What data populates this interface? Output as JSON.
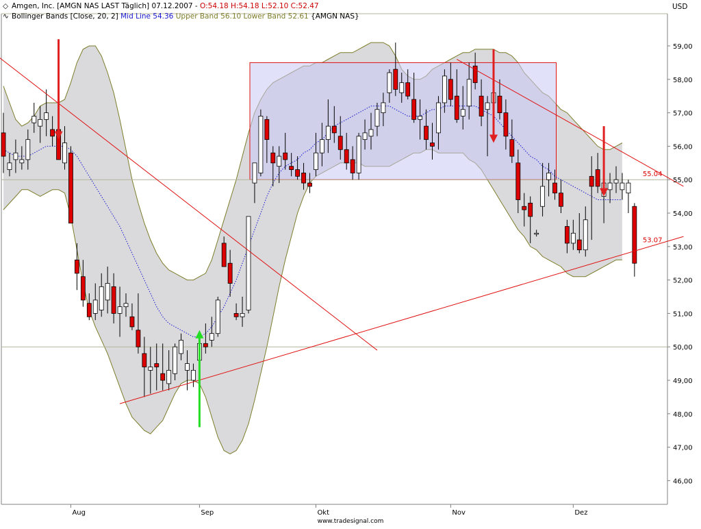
{
  "header": {
    "line1": "Amgen, Inc. [AMGN NAS LAST Täglich] 07.12.2007 - ",
    "ohlc": "O:54.18 H:54.18 L:52.10 C:52.47",
    "line2_prefix": "Bollinger Bands [Close, 20, 2] ",
    "mid": "Mid Line 54.36",
    "upper": "Upper Band 56.10",
    "lower": "Lower Band 52.61",
    "suffix": " {AMGN NAS}"
  },
  "currency": "USD",
  "footer": "www.tradesignal.com",
  "colors": {
    "up": "#ffffff",
    "down": "#dd0000",
    "band_fill": "#d3d3d6",
    "band_line": "#7d7d2c",
    "mid_line": "#1818d0",
    "trend": "#e01010",
    "box_fill": "#c8c8f5",
    "arrow_down": "#e02020",
    "arrow_up": "#22dd22"
  },
  "chart_data": {
    "type": "candlestick",
    "title": "Amgen, Inc. [AMGN NAS LAST Täglich] 07.12.2007",
    "ylabel": "USD",
    "ylim": [
      45.6,
      59.8
    ],
    "yticks": [
      "46,00",
      "47,00",
      "48,00",
      "49,00",
      "50,00",
      "51,00",
      "52,00",
      "53,00",
      "54,00",
      "55,00",
      "56,00",
      "57,00",
      "58,00",
      "59,00"
    ],
    "yvalues": [
      46,
      47,
      48,
      49,
      50,
      51,
      52,
      53,
      54,
      55,
      56,
      57,
      58,
      59
    ],
    "xticks": [
      {
        "label": "Aug",
        "idx": 11
      },
      {
        "label": "Sep",
        "idx": 32
      },
      {
        "label": "Okt",
        "idx": 51
      },
      {
        "label": "Nov",
        "idx": 73
      },
      {
        "label": "Dez",
        "idx": 93
      }
    ],
    "ohlc": [
      [
        56.4,
        57.0,
        55.2,
        55.7
      ],
      [
        55.3,
        55.8,
        55.1,
        55.5
      ],
      [
        55.6,
        56.2,
        55.2,
        55.8
      ],
      [
        55.5,
        56.0,
        55.3,
        55.6
      ],
      [
        55.6,
        56.5,
        55.3,
        56.2
      ],
      [
        56.7,
        57.3,
        56.4,
        56.9
      ],
      [
        56.6,
        57.2,
        56.1,
        56.8
      ],
      [
        56.8,
        57.7,
        56.3,
        57.0
      ],
      [
        56.5,
        56.9,
        56.0,
        56.3
      ],
      [
        56.5,
        57.2,
        55.9,
        55.6
      ],
      [
        55.5,
        56.6,
        55.3,
        56.1
      ],
      [
        55.8,
        56.0,
        53.7,
        53.7
      ],
      [
        52.6,
        53.1,
        51.7,
        52.2
      ],
      [
        52.1,
        52.6,
        51.2,
        51.4
      ],
      [
        51.3,
        51.6,
        50.8,
        50.9
      ],
      [
        51.0,
        51.9,
        50.8,
        51.4
      ],
      [
        51.1,
        52.2,
        50.9,
        51.8
      ],
      [
        51.4,
        52.4,
        51.0,
        51.9
      ],
      [
        51.8,
        52.2,
        50.7,
        51.0
      ],
      [
        51.0,
        51.8,
        50.3,
        51.2
      ],
      [
        51.2,
        51.6,
        50.9,
        51.3
      ],
      [
        50.9,
        51.3,
        50.5,
        50.6
      ],
      [
        50.5,
        51.6,
        49.8,
        50.0
      ],
      [
        49.8,
        50.3,
        48.5,
        49.4
      ],
      [
        49.3,
        50.0,
        48.6,
        49.4
      ],
      [
        49.5,
        50.1,
        48.7,
        49.4
      ],
      [
        49.2,
        50.1,
        48.7,
        49.0
      ],
      [
        48.9,
        49.9,
        48.7,
        49.3
      ],
      [
        49.2,
        50.1,
        49.0,
        50.0
      ],
      [
        49.8,
        50.4,
        49.6,
        50.2
      ],
      [
        49.3,
        49.9,
        48.7,
        49.5
      ],
      [
        49.0,
        49.5,
        48.8,
        49.3
      ],
      [
        49.6,
        50.4,
        49.3,
        50.1
      ],
      [
        50.1,
        50.7,
        49.8,
        50.0
      ],
      [
        50.2,
        50.9,
        50.0,
        50.4
      ],
      [
        50.4,
        51.5,
        50.3,
        51.4
      ],
      [
        53.1,
        53.3,
        52.4,
        52.4
      ],
      [
        52.5,
        52.9,
        51.5,
        51.9
      ],
      [
        51.0,
        51.3,
        50.8,
        50.9
      ],
      [
        50.9,
        51.5,
        50.6,
        51.0
      ],
      [
        51.1,
        53.4,
        51.0,
        53.9
      ],
      [
        54.9,
        55.5,
        54.3,
        55.5
      ],
      [
        55.2,
        57.1,
        55.1,
        56.9
      ],
      [
        56.8,
        56.9,
        55.5,
        56.2
      ],
      [
        55.8,
        56.0,
        54.8,
        55.5
      ],
      [
        55.4,
        56.0,
        54.9,
        55.7
      ],
      [
        55.8,
        56.4,
        55.3,
        55.6
      ],
      [
        55.4,
        55.8,
        55.1,
        55.3
      ],
      [
        55.3,
        55.7,
        55.0,
        55.1
      ],
      [
        55.2,
        55.5,
        54.7,
        54.9
      ],
      [
        54.9,
        55.2,
        54.6,
        54.8
      ],
      [
        55.3,
        56.4,
        55.1,
        55.8
      ],
      [
        55.8,
        56.7,
        55.4,
        56.2
      ],
      [
        56.2,
        57.4,
        55.8,
        56.6
      ],
      [
        56.6,
        57.2,
        56.1,
        56.4
      ],
      [
        56.3,
        56.9,
        55.6,
        55.9
      ],
      [
        55.9,
        56.4,
        55.3,
        55.5
      ],
      [
        55.6,
        56.0,
        55.0,
        55.2
      ],
      [
        55.2,
        56.4,
        55.0,
        56.3
      ],
      [
        56.2,
        56.8,
        55.9,
        56.4
      ],
      [
        56.3,
        57.0,
        55.9,
        56.5
      ],
      [
        56.6,
        57.3,
        56.3,
        57.1
      ],
      [
        57.0,
        57.6,
        56.6,
        57.3
      ],
      [
        57.6,
        58.3,
        57.3,
        58.2
      ],
      [
        58.3,
        59.1,
        57.5,
        57.7
      ],
      [
        57.6,
        58.2,
        57.3,
        57.9
      ],
      [
        57.9,
        58.3,
        57.4,
        57.5
      ],
      [
        57.4,
        58.2,
        56.7,
        56.8
      ],
      [
        56.8,
        57.4,
        56.2,
        56.9
      ],
      [
        56.6,
        57.1,
        55.9,
        56.2
      ],
      [
        56.1,
        56.7,
        55.6,
        56.0
      ],
      [
        56.4,
        57.5,
        55.9,
        57.3
      ],
      [
        57.3,
        58.3,
        57.0,
        58.1
      ],
      [
        58.0,
        58.5,
        57.2,
        57.4
      ],
      [
        57.5,
        58.3,
        56.7,
        56.8
      ],
      [
        56.9,
        57.8,
        56.5,
        57.1
      ],
      [
        57.2,
        58.5,
        56.8,
        58.0
      ],
      [
        58.4,
        58.8,
        57.7,
        57.9
      ],
      [
        57.5,
        58.0,
        56.6,
        56.9
      ],
      [
        57.1,
        57.5,
        55.7,
        57.3
      ],
      [
        57.3,
        57.8,
        56.9,
        57.6
      ],
      [
        57.5,
        58.0,
        56.8,
        57.0
      ],
      [
        57.0,
        57.4,
        55.9,
        56.3
      ],
      [
        56.2,
        56.8,
        55.5,
        55.7
      ],
      [
        55.5,
        55.9,
        54.0,
        54.4
      ],
      [
        54.2,
        54.6,
        53.6,
        54.1
      ],
      [
        54.3,
        54.5,
        53.1,
        53.9
      ],
      [
        53.4,
        53.5,
        53.3,
        53.4
      ],
      [
        54.2,
        55.5,
        53.9,
        54.8
      ],
      [
        55.0,
        55.5,
        54.5,
        55.2
      ],
      [
        54.9,
        55.3,
        54.4,
        54.6
      ],
      [
        54.6,
        55.0,
        54.0,
        54.2
      ],
      [
        53.6,
        53.8,
        52.8,
        53.1
      ],
      [
        53.1,
        53.8,
        52.9,
        53.4
      ],
      [
        53.2,
        54.0,
        52.8,
        52.9
      ],
      [
        52.9,
        54.2,
        52.7,
        53.8
      ],
      [
        55.1,
        55.7,
        53.2,
        54.8
      ],
      [
        55.3,
        55.8,
        54.6,
        54.8
      ],
      [
        54.5,
        55.5,
        53.7,
        54.9
      ],
      [
        54.7,
        55.2,
        54.3,
        54.9
      ],
      [
        54.9,
        55.4,
        54.6,
        55.0
      ],
      [
        54.7,
        55.2,
        54.4,
        54.9
      ],
      [
        54.6,
        55.0,
        54.0,
        54.9
      ],
      [
        54.2,
        54.3,
        52.1,
        52.5
      ]
    ],
    "bollinger": {
      "params": "Close, 20, 2",
      "mid_last": 54.36,
      "upper_last": 56.1,
      "lower_last": 52.61,
      "upper": [
        57.8,
        57.3,
        56.8,
        56.6,
        56.7,
        56.9,
        57.2,
        57.3,
        57.3,
        57.3,
        57.4,
        57.9,
        58.5,
        58.9,
        59.0,
        59.0,
        58.7,
        58.2,
        57.6,
        56.8,
        55.9,
        55.0,
        54.3,
        53.7,
        53.2,
        52.8,
        52.5,
        52.3,
        52.2,
        52.1,
        52.0,
        52.0,
        52.1,
        52.2,
        52.6,
        53.2,
        53.8,
        54.4,
        55.0,
        55.7,
        56.4,
        57.0,
        57.4,
        57.7,
        57.9,
        58.0,
        58.1,
        58.2,
        58.3,
        58.4,
        58.4,
        58.5,
        58.5,
        58.6,
        58.7,
        58.8,
        58.8,
        58.8,
        58.9,
        59.0,
        59.1,
        59.1,
        59.1,
        59.0,
        58.7,
        58.3,
        58.1,
        58.0,
        58.0,
        58.1,
        58.3,
        58.4,
        58.5,
        58.6,
        58.7,
        58.8,
        58.8,
        58.9,
        58.9,
        58.9,
        58.9,
        58.8,
        58.8,
        58.7,
        58.5,
        58.2,
        58.0,
        57.8,
        57.6,
        57.5,
        57.3,
        57.1,
        57.0,
        56.8,
        56.6,
        56.4,
        56.2,
        56.0,
        55.9,
        55.9,
        56.0,
        56.1
      ],
      "mid": [
        55.9,
        55.8,
        55.7,
        55.7,
        55.7,
        55.8,
        55.9,
        56.0,
        56.0,
        56.0,
        56.0,
        55.9,
        55.7,
        55.4,
        55.1,
        54.8,
        54.5,
        54.2,
        53.9,
        53.6,
        53.2,
        52.8,
        52.4,
        52.0,
        51.6,
        51.2,
        50.9,
        50.7,
        50.6,
        50.5,
        50.4,
        50.3,
        50.3,
        50.4,
        50.6,
        50.9,
        51.2,
        51.6,
        52.0,
        52.5,
        53.0,
        53.5,
        54.0,
        54.5,
        54.9,
        55.2,
        55.4,
        55.5,
        55.6,
        55.8,
        55.9,
        56.1,
        56.2,
        56.4,
        56.6,
        56.7,
        56.8,
        56.9,
        57.0,
        57.1,
        57.2,
        57.2,
        57.2,
        57.2,
        57.1,
        57.0,
        56.9,
        56.9,
        56.9,
        57.0,
        57.1,
        57.1,
        57.2,
        57.2,
        57.2,
        57.2,
        57.2,
        57.2,
        57.1,
        57.0,
        56.9,
        56.7,
        56.5,
        56.3,
        56.1,
        55.9,
        55.7,
        55.6,
        55.4,
        55.3,
        55.1,
        55.0,
        54.9,
        54.8,
        54.7,
        54.6,
        54.5,
        54.4,
        54.4,
        54.4,
        54.4,
        54.4
      ],
      "lower": [
        54.1,
        54.3,
        54.5,
        54.7,
        54.7,
        54.6,
        54.5,
        54.6,
        54.7,
        54.7,
        54.6,
        53.9,
        52.9,
        51.9,
        51.1,
        50.6,
        50.2,
        49.8,
        49.3,
        48.8,
        48.3,
        47.9,
        47.7,
        47.5,
        47.4,
        47.6,
        47.8,
        48.2,
        48.6,
        48.9,
        49.0,
        49.0,
        48.9,
        48.5,
        47.9,
        47.3,
        46.9,
        46.8,
        46.9,
        47.2,
        47.7,
        48.4,
        49.2,
        50.0,
        50.9,
        51.8,
        52.6,
        53.3,
        54.0,
        54.5,
        54.9,
        55.1,
        55.2,
        55.3,
        55.4,
        55.5,
        55.5,
        55.5,
        55.5,
        55.4,
        55.4,
        55.4,
        55.4,
        55.4,
        55.5,
        55.6,
        55.7,
        55.8,
        55.8,
        55.9,
        55.9,
        55.8,
        55.8,
        55.8,
        55.8,
        55.8,
        55.6,
        55.5,
        55.3,
        55.0,
        54.7,
        54.4,
        54.1,
        53.8,
        53.5,
        53.3,
        53.0,
        52.9,
        52.7,
        52.6,
        52.5,
        52.4,
        52.2,
        52.1,
        52.1,
        52.1,
        52.2,
        52.3,
        52.4,
        52.5,
        52.6,
        52.6
      ]
    },
    "hlines": [
      {
        "value": 55.0,
        "color": "#b4b49a"
      },
      {
        "value": 50.0,
        "color": "#b4b49a"
      }
    ],
    "trendlines": [
      {
        "from": [
          -1,
          58.7
        ],
        "to": [
          61,
          49.9
        ]
      },
      {
        "from": [
          19,
          48.3
        ],
        "to": [
          111,
          53.3
        ]
      },
      {
        "from": [
          74,
          58.6
        ],
        "to": [
          111,
          54.8
        ]
      }
    ],
    "box": {
      "x0": 40,
      "x1": 90,
      "y0": 55.0,
      "y1": 58.5
    },
    "price_labels": [
      {
        "text": "55.04",
        "idx": 102,
        "value": 55.04
      },
      {
        "text": "53.07",
        "idx": 102,
        "value": 53.07
      }
    ],
    "arrows": [
      {
        "dir": "down",
        "idx": 9,
        "from": 59.2,
        "to": 56.2
      },
      {
        "dir": "down",
        "idx": 80,
        "from": 58.9,
        "to": 56.1
      },
      {
        "dir": "down",
        "idx": 98,
        "from": 56.6,
        "to": 54.5
      },
      {
        "dir": "up",
        "idx": 32,
        "from": 47.6,
        "to": 50.5
      }
    ]
  }
}
